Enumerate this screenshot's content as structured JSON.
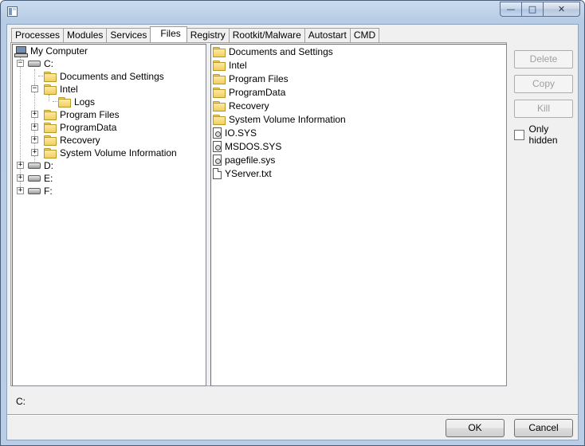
{
  "window": {
    "title": ""
  },
  "tabs": [
    {
      "label": "Processes",
      "active": false
    },
    {
      "label": "Modules",
      "active": false
    },
    {
      "label": "Services",
      "active": false
    },
    {
      "label": "Files",
      "active": true
    },
    {
      "label": "Registry",
      "active": false
    },
    {
      "label": "Rootkit/Malware",
      "active": false
    },
    {
      "label": "Autostart",
      "active": false
    },
    {
      "label": "CMD",
      "active": false
    }
  ],
  "tree": {
    "root": "My Computer",
    "nodes": [
      {
        "label": "C:",
        "type": "drive",
        "expander": "−"
      },
      {
        "label": "Documents and Settings",
        "type": "folder",
        "expander": ""
      },
      {
        "label": "Intel",
        "type": "folder",
        "expander": "−"
      },
      {
        "label": "Logs",
        "type": "folder",
        "expander": ""
      },
      {
        "label": "Program Files",
        "type": "folder",
        "expander": "+"
      },
      {
        "label": "ProgramData",
        "type": "folder",
        "expander": "+"
      },
      {
        "label": "Recovery",
        "type": "folder",
        "expander": "+"
      },
      {
        "label": "System Volume Information",
        "type": "folder",
        "expander": "+"
      },
      {
        "label": "D:",
        "type": "drive",
        "expander": "+"
      },
      {
        "label": "E:",
        "type": "drive",
        "expander": "+"
      },
      {
        "label": "F:",
        "type": "drive",
        "expander": "+"
      }
    ]
  },
  "files": [
    {
      "name": "Documents and Settings",
      "type": "folder"
    },
    {
      "name": "Intel",
      "type": "folder"
    },
    {
      "name": "Program Files",
      "type": "folder"
    },
    {
      "name": "ProgramData",
      "type": "folder"
    },
    {
      "name": "Recovery",
      "type": "folder"
    },
    {
      "name": "System Volume Information",
      "type": "folder"
    },
    {
      "name": "IO.SYS",
      "type": "sysfile"
    },
    {
      "name": "MSDOS.SYS",
      "type": "sysfile"
    },
    {
      "name": "pagefile.sys",
      "type": "sysfile"
    },
    {
      "name": "YServer.txt",
      "type": "txtfile"
    }
  ],
  "actions": {
    "delete": "Delete",
    "copy": "Copy",
    "kill": "Kill",
    "only_hidden": "Only hidden"
  },
  "status": {
    "path": "C:"
  },
  "dialog": {
    "ok": "OK",
    "cancel": "Cancel"
  },
  "caption": {
    "minimize": "—",
    "maximize": "□",
    "close": "✕"
  }
}
